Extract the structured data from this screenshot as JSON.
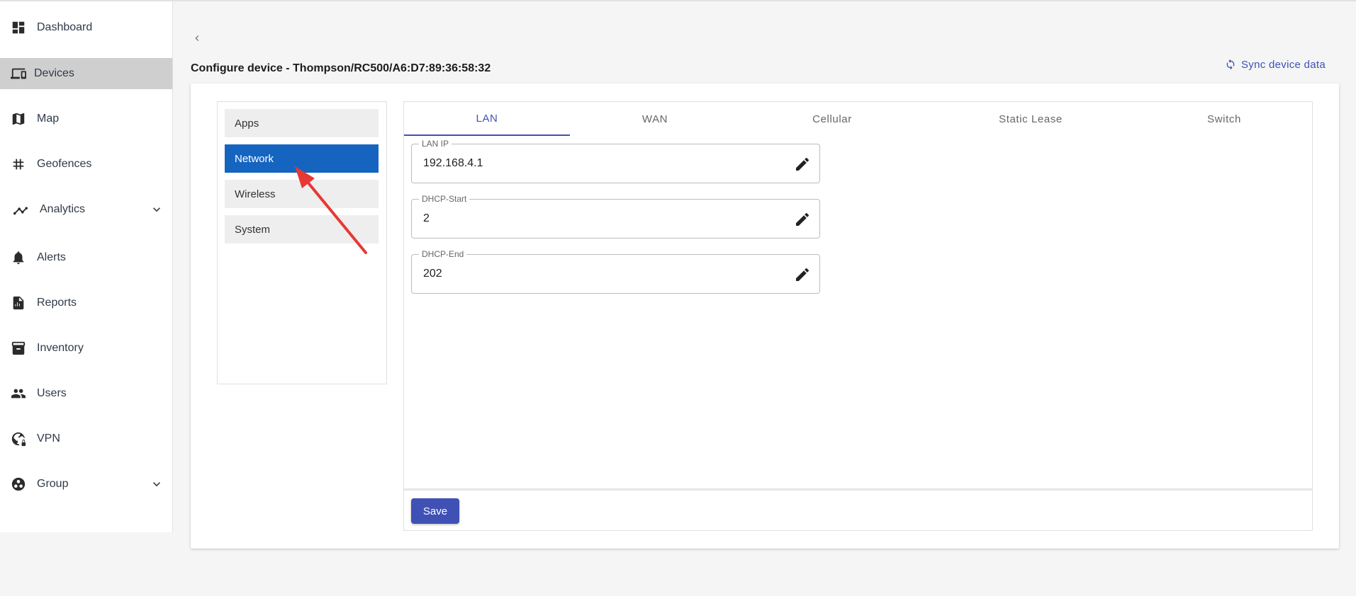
{
  "sidebar": {
    "items": [
      {
        "label": "Dashboard",
        "icon": "dashboard-icon"
      },
      {
        "label": "Devices",
        "icon": "devices-icon",
        "active": true
      },
      {
        "label": "Map",
        "icon": "map-icon"
      },
      {
        "label": "Geofences",
        "icon": "geofences-icon"
      },
      {
        "label": "Analytics",
        "icon": "analytics-icon",
        "expandable": true
      },
      {
        "label": "Alerts",
        "icon": "bell-icon"
      },
      {
        "label": "Reports",
        "icon": "reports-icon"
      },
      {
        "label": "Inventory",
        "icon": "inventory-icon"
      },
      {
        "label": "Users",
        "icon": "users-icon"
      },
      {
        "label": "VPN",
        "icon": "vpn-icon"
      },
      {
        "label": "Group",
        "icon": "group-icon",
        "expandable": true
      }
    ]
  },
  "header": {
    "title": "Configure device - Thompson/RC500/A6:D7:89:36:58:32",
    "sync_label": "Sync device data"
  },
  "config_menu": {
    "items": [
      {
        "label": "Apps"
      },
      {
        "label": "Network",
        "active": true
      },
      {
        "label": "Wireless"
      },
      {
        "label": "System"
      }
    ]
  },
  "tabs": [
    {
      "label": "LAN",
      "active": true
    },
    {
      "label": "WAN"
    },
    {
      "label": "Cellular"
    },
    {
      "label": "Static Lease"
    },
    {
      "label": "Switch"
    }
  ],
  "fields": [
    {
      "label": "LAN IP",
      "value": "192.168.4.1"
    },
    {
      "label": "DHCP-Start",
      "value": "2"
    },
    {
      "label": "DHCP-End",
      "value": "202"
    }
  ],
  "footer": {
    "save_label": "Save"
  },
  "colors": {
    "accent": "#3f51b5",
    "menu_active": "#1565c0",
    "sidebar_active": "#cfcfcf",
    "annotation_arrow": "#e53935"
  }
}
